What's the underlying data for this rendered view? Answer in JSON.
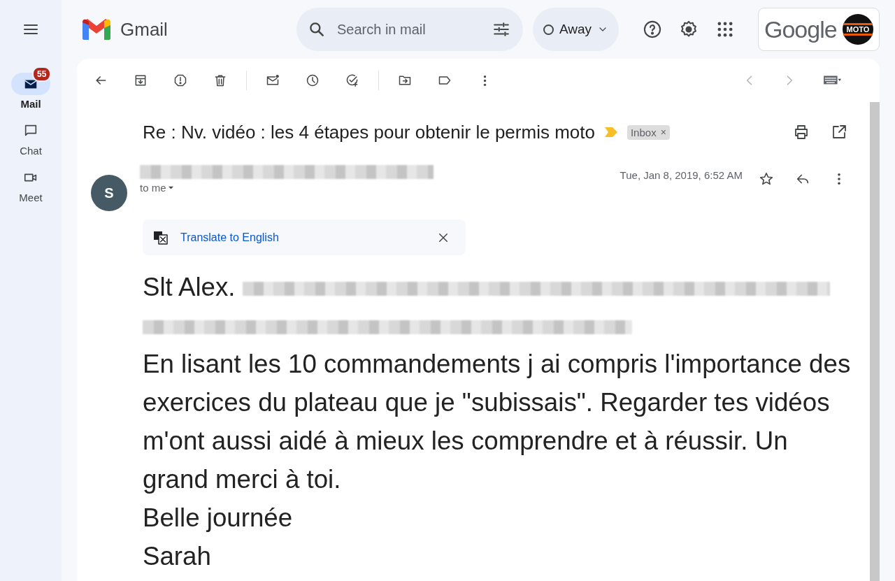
{
  "rail": {
    "items": [
      {
        "label": "Mail",
        "selected": true,
        "badge": "55"
      },
      {
        "label": "Chat",
        "selected": false
      },
      {
        "label": "Meet",
        "selected": false
      }
    ]
  },
  "header": {
    "product": "Gmail",
    "search": {
      "placeholder": "Search in mail"
    },
    "status": "Away",
    "account": {
      "brand": "Google",
      "logo_text": "MOTO"
    }
  },
  "message": {
    "subject": "Re : Nv. vidéo : les 4 étapes pour obtenir le permis moto",
    "important": true,
    "label": "Inbox",
    "label_remove": "×",
    "sender_initial": "S",
    "sender_redacted": true,
    "recipient": "to me",
    "date": "Tue, Jan 8, 2019, 6:52 AM",
    "starred": false,
    "translate": "Translate to English",
    "greeting": "Slt Alex.",
    "greeting_redacted": true,
    "paragraphs": [
      "En lisant les 10 commandements j ai compris l'importance des exercices du plateau que je \"subissais\". Regarder tes vidéos m'ont aussi aidé à mieux les comprendre et à réussir. Un grand merci à toi.",
      "Belle journée",
      "Sarah"
    ]
  }
}
